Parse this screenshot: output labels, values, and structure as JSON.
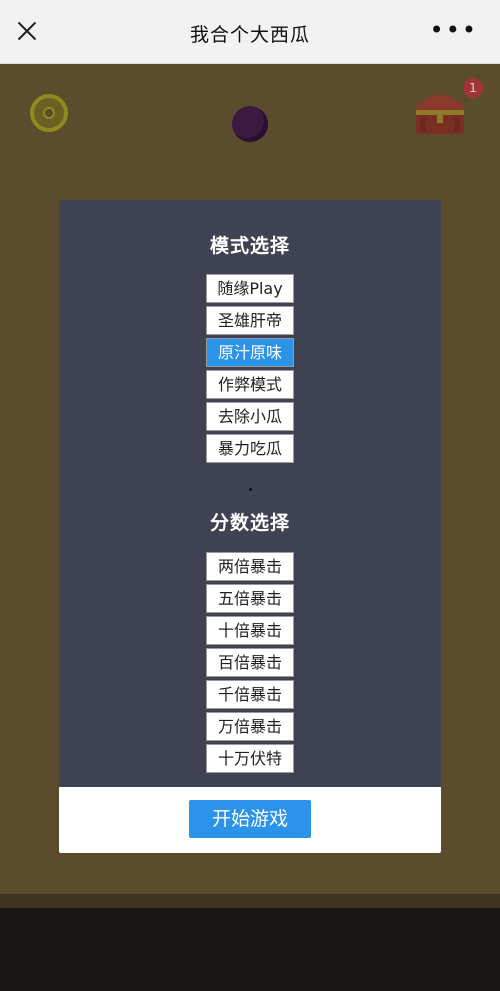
{
  "topbar": {
    "title": "我合个大西瓜",
    "close_icon": "close-icon",
    "more_glyph": "•••"
  },
  "game": {
    "chest_badge_count": "1"
  },
  "modal": {
    "mode_title": "模式选择",
    "modes": [
      {
        "label": "随缘Play",
        "selected": false
      },
      {
        "label": "圣雄肝帝",
        "selected": false
      },
      {
        "label": "原汁原味",
        "selected": true
      },
      {
        "label": "作弊模式",
        "selected": false
      },
      {
        "label": "去除小瓜",
        "selected": false
      },
      {
        "label": "暴力吃瓜",
        "selected": false
      }
    ],
    "score_title": "分数选择",
    "scores": [
      {
        "label": "两倍暴击"
      },
      {
        "label": "五倍暴击"
      },
      {
        "label": "十倍暴击"
      },
      {
        "label": "百倍暴击"
      },
      {
        "label": "千倍暴击"
      },
      {
        "label": "万倍暴击"
      },
      {
        "label": "十万伏特"
      }
    ],
    "start_label": "开始游戏"
  },
  "colors": {
    "accent": "#2c93ea",
    "modal_bg": "#3f4252",
    "game_bg_dimmed": "#5a4c2c"
  }
}
